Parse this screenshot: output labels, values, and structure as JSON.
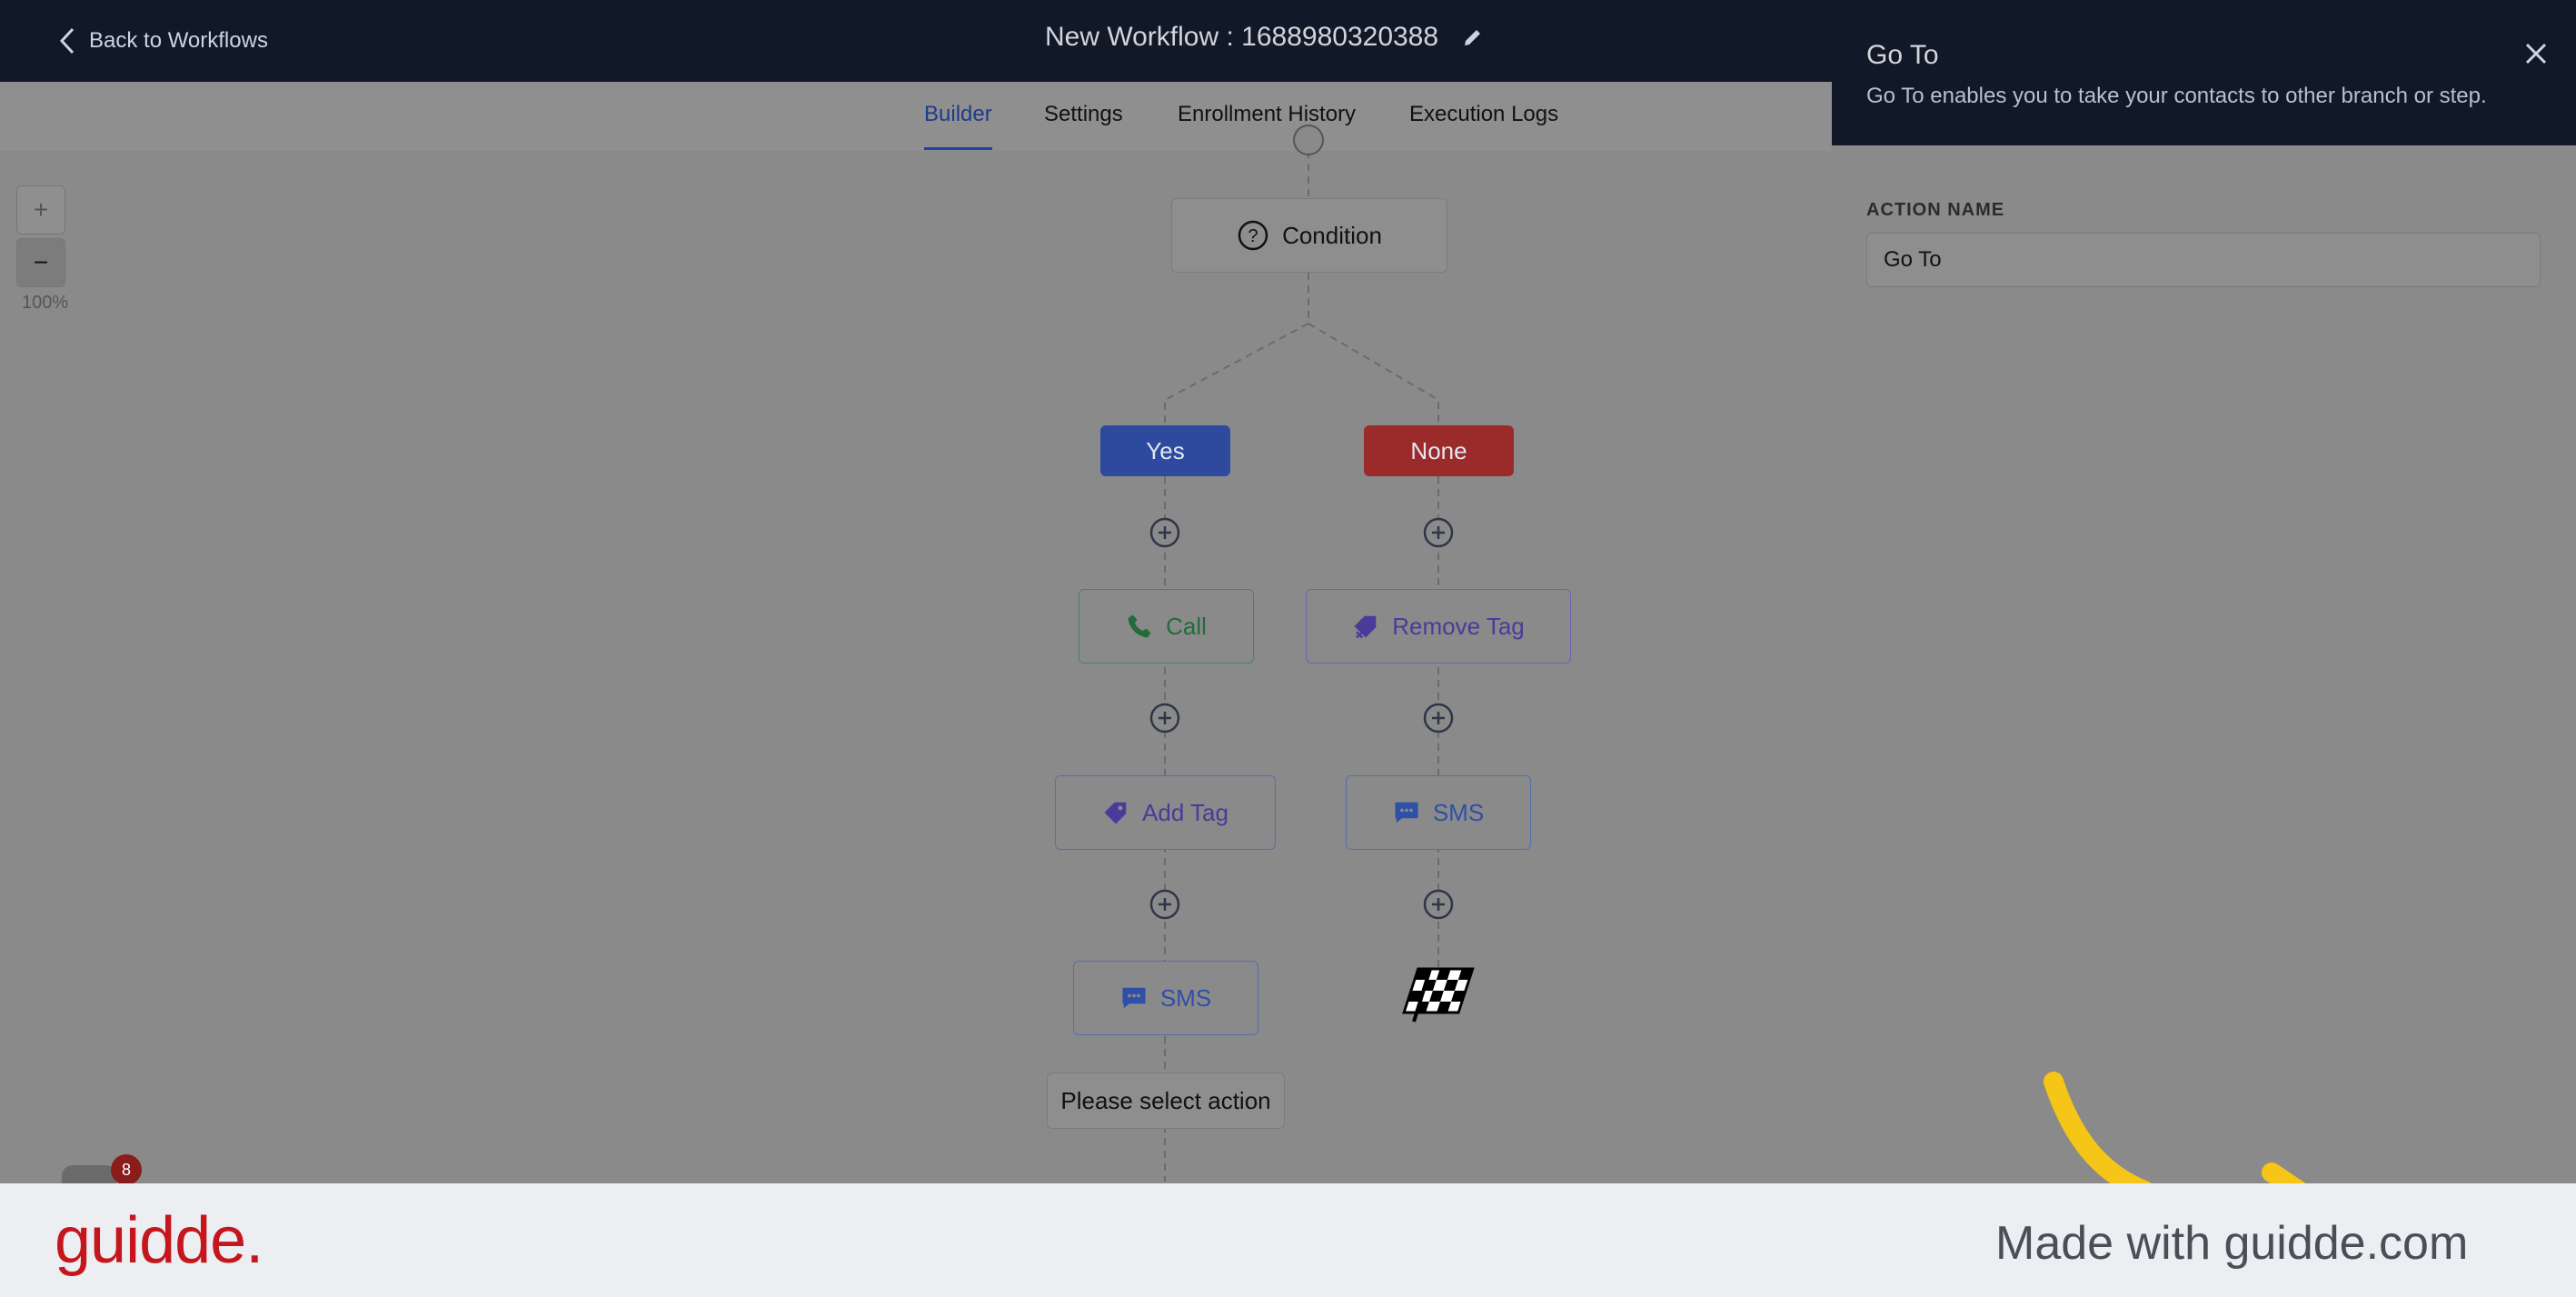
{
  "header": {
    "back_label": "Back to Workflows",
    "workflow_title": "New Workflow : 1688980320388"
  },
  "tabs": [
    {
      "label": "Builder",
      "active": true
    },
    {
      "label": "Settings",
      "active": false
    },
    {
      "label": "Enrollment History",
      "active": false
    },
    {
      "label": "Execution Logs",
      "active": false
    }
  ],
  "zoom": {
    "plus": "+",
    "minus": "−",
    "level": "100%"
  },
  "flow": {
    "condition": "Condition",
    "branches": {
      "yes": {
        "label": "Yes",
        "steps": [
          "Call",
          "Add Tag",
          "SMS"
        ]
      },
      "none": {
        "label": "None",
        "steps": [
          "Remove Tag",
          "SMS"
        ]
      }
    },
    "pending": "Please select action"
  },
  "chat": {
    "badge_count": "8"
  },
  "panel": {
    "title": "Go To",
    "description": "Go To enables you to take your contacts to other branch or step.",
    "field_label": "ACTION NAME",
    "field_value": "Go To"
  },
  "footer": {
    "logo_text": "guidde.",
    "made_with": "Made with guidde.com"
  },
  "colors": {
    "header_bg": "#111827",
    "yes_branch": "#2d4a9e",
    "none_branch": "#9b2b2b",
    "logo_red": "#c4161c"
  }
}
